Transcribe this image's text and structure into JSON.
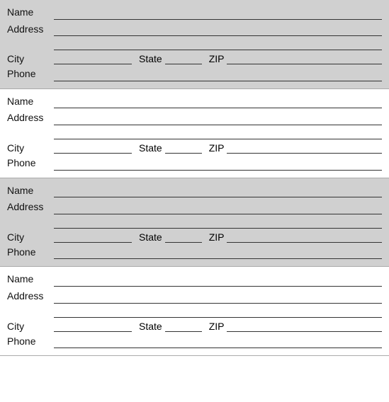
{
  "blocks": [
    {
      "shaded": true
    },
    {
      "shaded": false
    },
    {
      "shaded": true
    },
    {
      "shaded": false
    }
  ],
  "labels": {
    "name": "Name",
    "address": "Address",
    "city": "City",
    "state": "State",
    "zip": "ZIP",
    "phone": "Phone"
  }
}
